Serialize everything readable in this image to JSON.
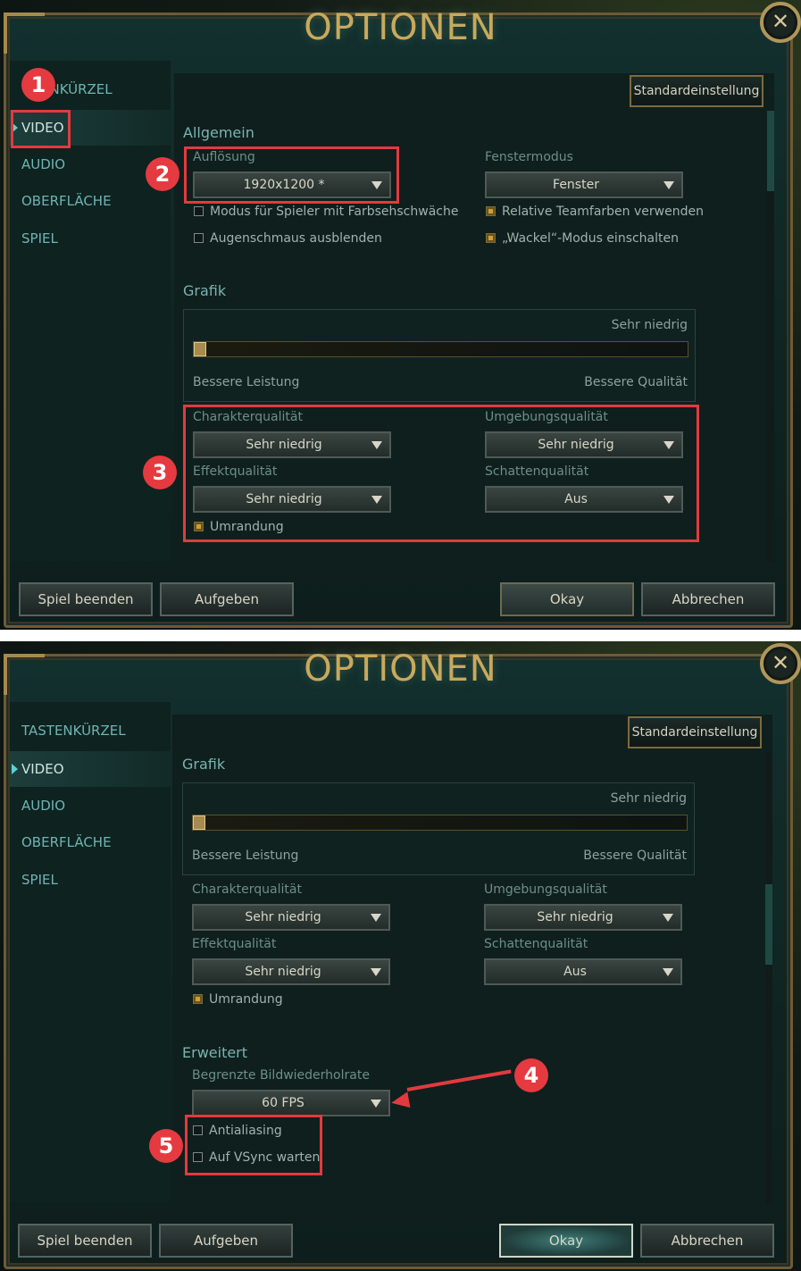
{
  "window_title": "OPTIONEN",
  "close_glyph": "✕",
  "sidebar": {
    "items": [
      {
        "label": "TASTENKÜRZEL",
        "top_label": "ENKÜRZEL"
      },
      {
        "label": "VIDEO"
      },
      {
        "label": "AUDIO"
      },
      {
        "label": "OBERFLÄCHE"
      },
      {
        "label": "SPIEL"
      }
    ]
  },
  "top_button": "Standardeinstellung",
  "allgemein": {
    "heading": "Allgemein",
    "resolution_label": "Auflösung",
    "resolution_value": "1920x1200 *",
    "window_mode_label": "Fenstermodus",
    "window_mode_value": "Fenster",
    "checkboxes": [
      {
        "label": "Modus für Spieler mit Farbsehschwäche",
        "checked": false
      },
      {
        "label": "Relative Teamfarben verwenden",
        "checked": true
      },
      {
        "label": "Augenschmaus ausblenden",
        "checked": false
      },
      {
        "label": "„Wackel“-Modus einschalten",
        "checked": true
      }
    ]
  },
  "grafik": {
    "heading": "Grafik",
    "preset": "Sehr niedrig",
    "slider_level": 0,
    "left_label": "Bessere Leistung",
    "right_label": "Bessere Qualität",
    "character_label": "Charakterqualität",
    "character_value": "Sehr niedrig",
    "environment_label": "Umgebungsqualität",
    "environment_value": "Sehr niedrig",
    "effects_label": "Effektqualität",
    "effects_value": "Sehr niedrig",
    "shadow_label": "Schattenqualität",
    "shadow_value": "Aus",
    "outline_label": "Umrandung",
    "outline_checked": true
  },
  "erweitert": {
    "heading": "Erweitert",
    "framerate_label": "Begrenzte Bildwiederholrate",
    "framerate_value": "60 FPS",
    "antialiasing_label": "Antialiasing",
    "antialiasing_checked": false,
    "vsync_label": "Auf VSync warten",
    "vsync_checked": false
  },
  "buttons": {
    "quit": "Spiel beenden",
    "surrender": "Aufgeben",
    "okay": "Okay",
    "cancel": "Abbrechen"
  },
  "annotations": {
    "badges": [
      "1",
      "2",
      "3",
      "4",
      "5"
    ],
    "highlight_color": "#e23a3f"
  },
  "colors": {
    "gold": "#c8a95c",
    "teal_text": "#79b4b0",
    "panel_bg": "#0f1f1d"
  }
}
